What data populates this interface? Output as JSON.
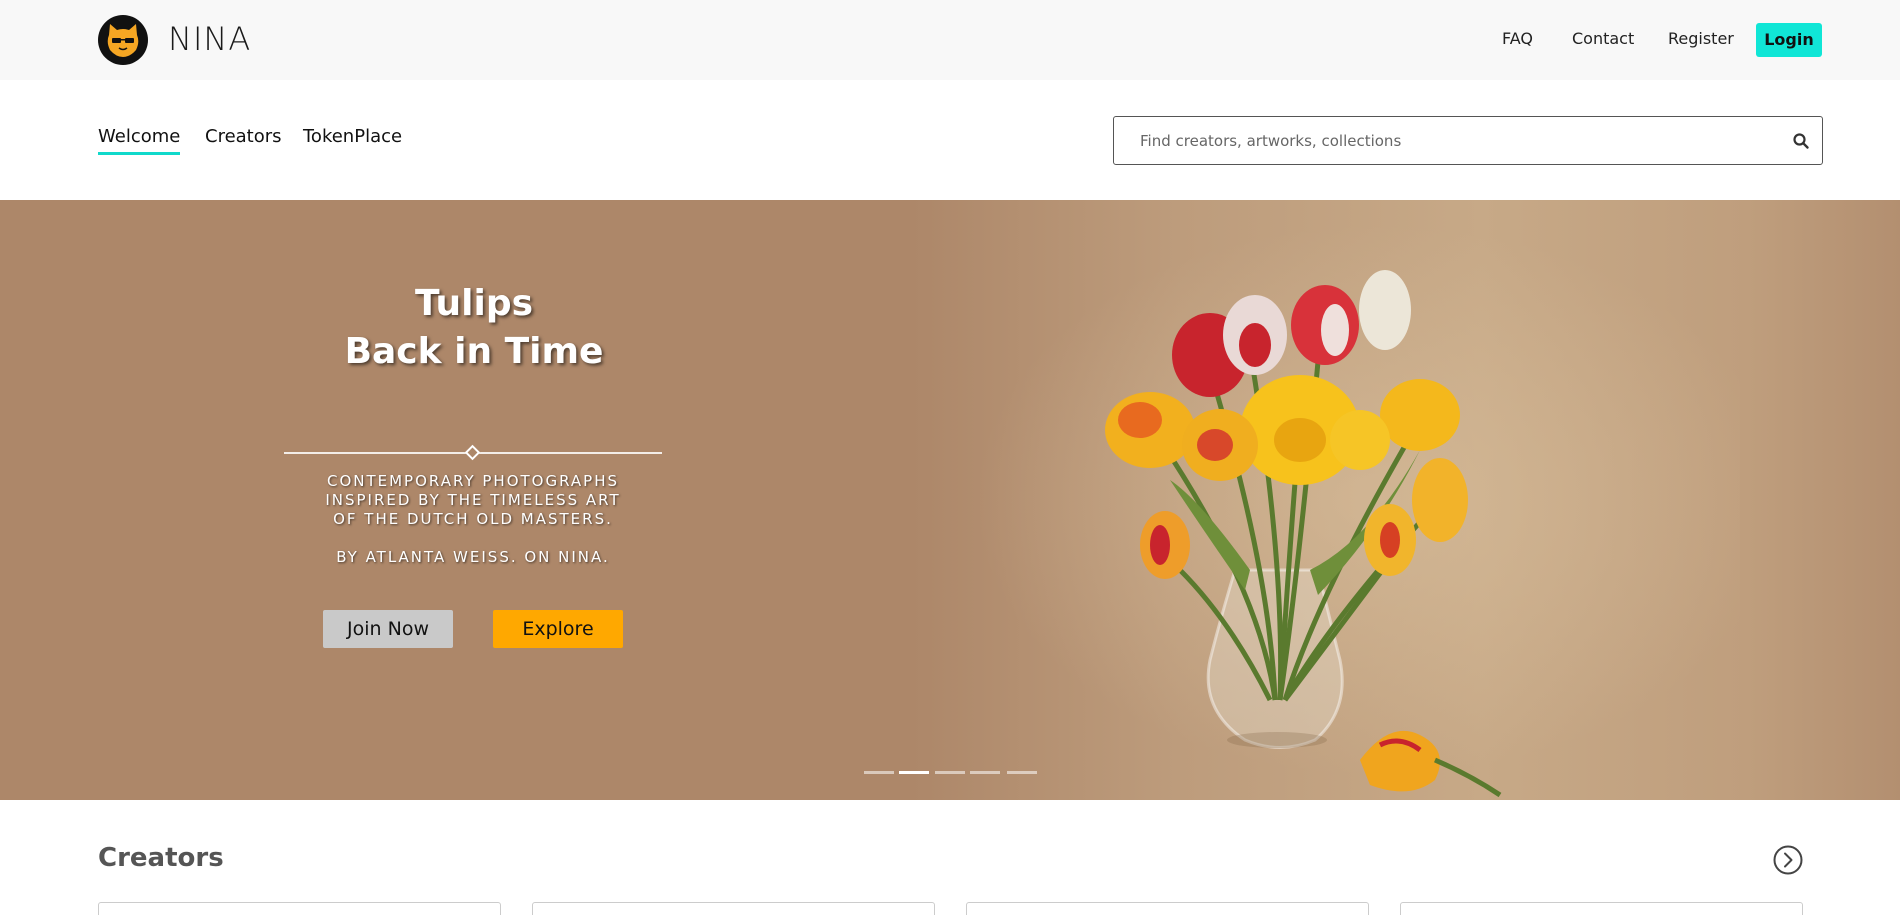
{
  "header": {
    "brand": "NINA",
    "links": [
      "FAQ",
      "Contact",
      "Register"
    ],
    "login_label": "Login",
    "accent_color": "#10e6d6"
  },
  "nav": {
    "tabs": [
      {
        "label": "Welcome",
        "active": true
      },
      {
        "label": "Creators",
        "active": false
      },
      {
        "label": "TokenPlace",
        "active": false
      }
    ]
  },
  "search": {
    "placeholder": "Find creators, artworks, collections",
    "icon": "search-icon"
  },
  "hero": {
    "title_line1": "Tulips",
    "title_line2": "Back in Time",
    "subtitle_line1": "CONTEMPORARY PHOTOGRAPHS",
    "subtitle_line2": "INSPIRED BY THE TIMELESS ART",
    "subtitle_line3": "OF THE DUTCH OLD MASTERS.",
    "byline": "BY ATLANTA WEISS. ON NINA.",
    "join_label": "Join Now",
    "explore_label": "Explore",
    "slide_count": 5,
    "active_slide": 2,
    "background_color": "#ad8769",
    "explore_color": "#ffa800"
  },
  "creators": {
    "title": "Creators",
    "next_icon": "chevron-right-circle-icon",
    "visible_cards": 4
  }
}
